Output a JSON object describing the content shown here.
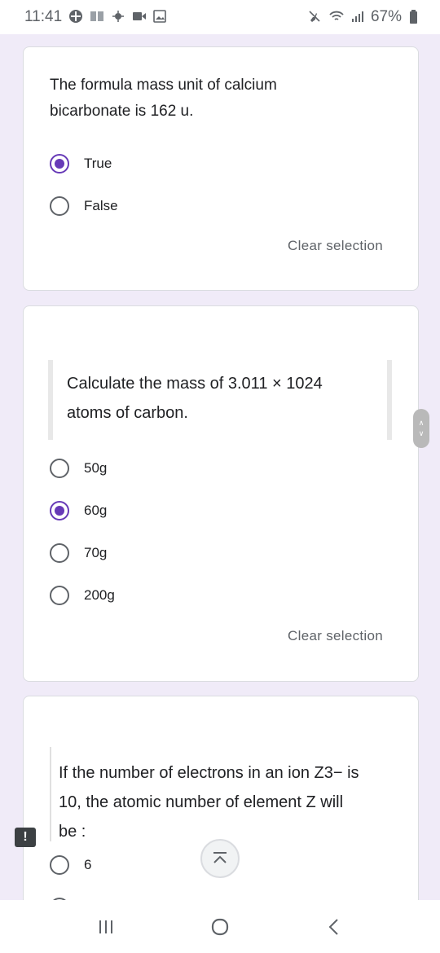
{
  "status_bar": {
    "time": "11:41",
    "battery": "67%",
    "left_icons": [
      "app-icon",
      "notification-icon",
      "weather-icon",
      "video-icon",
      "gallery-icon"
    ],
    "right_icons": [
      "mute-icon",
      "wifi-icon",
      "signal-icon",
      "battery-icon"
    ]
  },
  "questions": [
    {
      "text_lines": [
        "The formula mass unit of calcium",
        "bicarbonate is 162 u."
      ],
      "options": [
        {
          "label": "True",
          "checked": true
        },
        {
          "label": "False",
          "checked": false
        }
      ],
      "clear_label": "Clear selection"
    },
    {
      "text_lines": [
        "Calculate the mass of 3.011 × 1024",
        "atoms of carbon."
      ],
      "options": [
        {
          "label": "50g",
          "checked": false
        },
        {
          "label": "60g",
          "checked": true
        },
        {
          "label": "70g",
          "checked": false
        },
        {
          "label": "200g",
          "checked": false
        }
      ],
      "clear_label": "Clear selection"
    },
    {
      "text_lines": [
        "If the number of electrons in an ion Z3− is",
        "10, the atomic number of element Z will",
        "be :"
      ],
      "options": [
        {
          "label": "6",
          "checked": false
        }
      ]
    }
  ],
  "accent_color": "#673ab7",
  "report_icon_text": "!"
}
